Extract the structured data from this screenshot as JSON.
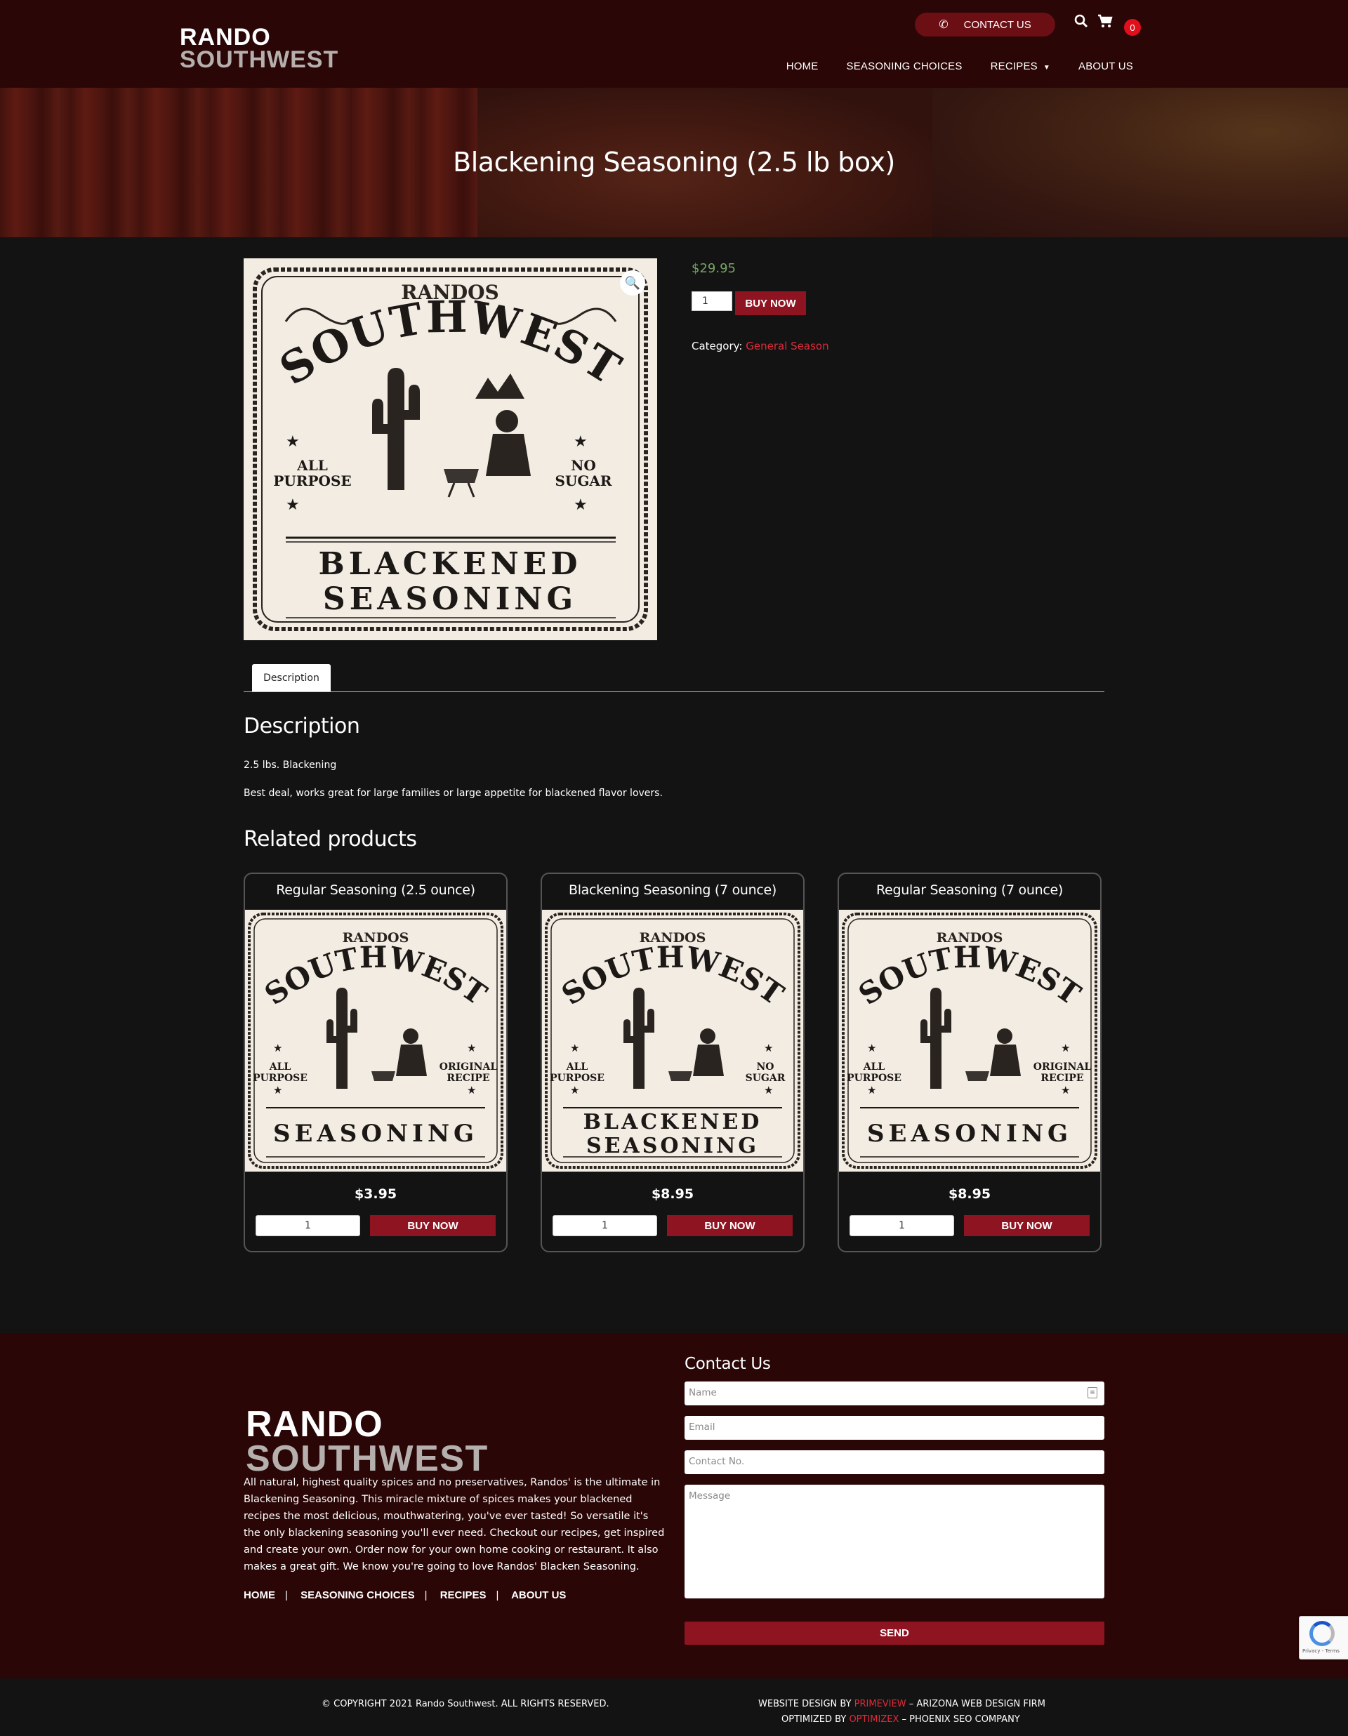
{
  "header": {
    "logo_line1": "RANDO",
    "logo_line2": "SOUTHWEST",
    "contact_label": "CONTACT US",
    "cart_count": "0",
    "nav": [
      "HOME",
      "SEASONING CHOICES",
      "RECIPES",
      "ABOUT US"
    ]
  },
  "hero": {
    "title": "Blackening Seasoning (2.5 lb box)"
  },
  "product": {
    "price": "$29.95",
    "quantity": "1",
    "buy_label": "BUY NOW",
    "category_label": "Category:",
    "category_value": "General Season",
    "label": {
      "top": "RANDOS",
      "arc": "SOUTHWEST",
      "left": [
        "ALL",
        "PURPOSE"
      ],
      "right": [
        "NO",
        "SUGAR"
      ],
      "bottom1": "BLACKENED",
      "bottom2": "SEASONING"
    }
  },
  "tabs": {
    "description": "Description"
  },
  "description": {
    "heading": "Description",
    "p1": "2.5 lbs.  Blackening",
    "p2": "Best deal, works great for large families or large appetite for blackened flavor lovers."
  },
  "related": {
    "heading": "Related products",
    "items": [
      {
        "title": "Regular Seasoning (2.5 ounce)",
        "price": "$3.95",
        "qty": "1",
        "buy": "BUY NOW",
        "label": {
          "top": "RANDOS",
          "arc": "SOUTHWEST",
          "left": [
            "ALL",
            "PURPOSE"
          ],
          "right": [
            "ORIGINAL",
            "RECIPE"
          ],
          "bottom1": "",
          "bottom2": "SEASONING"
        }
      },
      {
        "title": "Blackening Seasoning (7 ounce)",
        "price": "$8.95",
        "qty": "1",
        "buy": "BUY NOW",
        "label": {
          "top": "RANDOS",
          "arc": "SOUTHWEST",
          "left": [
            "ALL",
            "PURPOSE"
          ],
          "right": [
            "NO",
            "SUGAR"
          ],
          "bottom1": "BLACKENED",
          "bottom2": "SEASONING"
        }
      },
      {
        "title": "Regular Seasoning (7 ounce)",
        "price": "$8.95",
        "qty": "1",
        "buy": "BUY NOW",
        "label": {
          "top": "RANDOS",
          "arc": "SOUTHWEST",
          "left": [
            "ALL",
            "PURPOSE"
          ],
          "right": [
            "ORIGINAL",
            "RECIPE"
          ],
          "bottom1": "",
          "bottom2": "SEASONING"
        }
      }
    ]
  },
  "footer": {
    "logo_line1": "RANDO",
    "logo_line2": "SOUTHWEST",
    "about": "All natural, highest quality spices and no preservatives,  Randos' is the ultimate in Blackening Seasoning. This miracle mixture of spices makes your blackened recipes the most delicious, mouthwatering, you've ever tasted! So versatile it's the only blackening seasoning you'll ever need. Checkout our recipes, get inspired and create your own. Order now for your own home cooking or restaurant.  It also makes a great gift. We know you're going to love  Randos'  Blacken Seasoning.",
    "links": [
      "HOME",
      "SEASONING CHOICES",
      "RECIPES",
      "ABOUT US"
    ],
    "contact_heading": "Contact Us",
    "name_placeholder": "Name",
    "email_placeholder": "Email",
    "phone_placeholder": "Contact No.",
    "message_placeholder": "Message",
    "send_label": "SEND",
    "recaptcha_text": "Privacy - Terms"
  },
  "copyright": {
    "left": "© COPYRIGHT 2021  Rando Southwest. ALL  RIGHTS  RESERVED.",
    "design_prefix": "WEBSITE  DESIGN  BY ",
    "design_brand": "PRIMEVIEW",
    "design_suffix": " – ARIZONA WEB  DESIGN  FIRM",
    "opt_prefix": "OPTIMIZED  BY ",
    "opt_brand": "OPTIMIZEX",
    "opt_suffix": " –  PHOENIX SEO COMPANY"
  },
  "colors": {
    "header_bg": "#2a0606",
    "page_bg": "#131313",
    "button_red": "#8f1422",
    "price_green": "#77a464",
    "link_red": "#e02b3a"
  }
}
